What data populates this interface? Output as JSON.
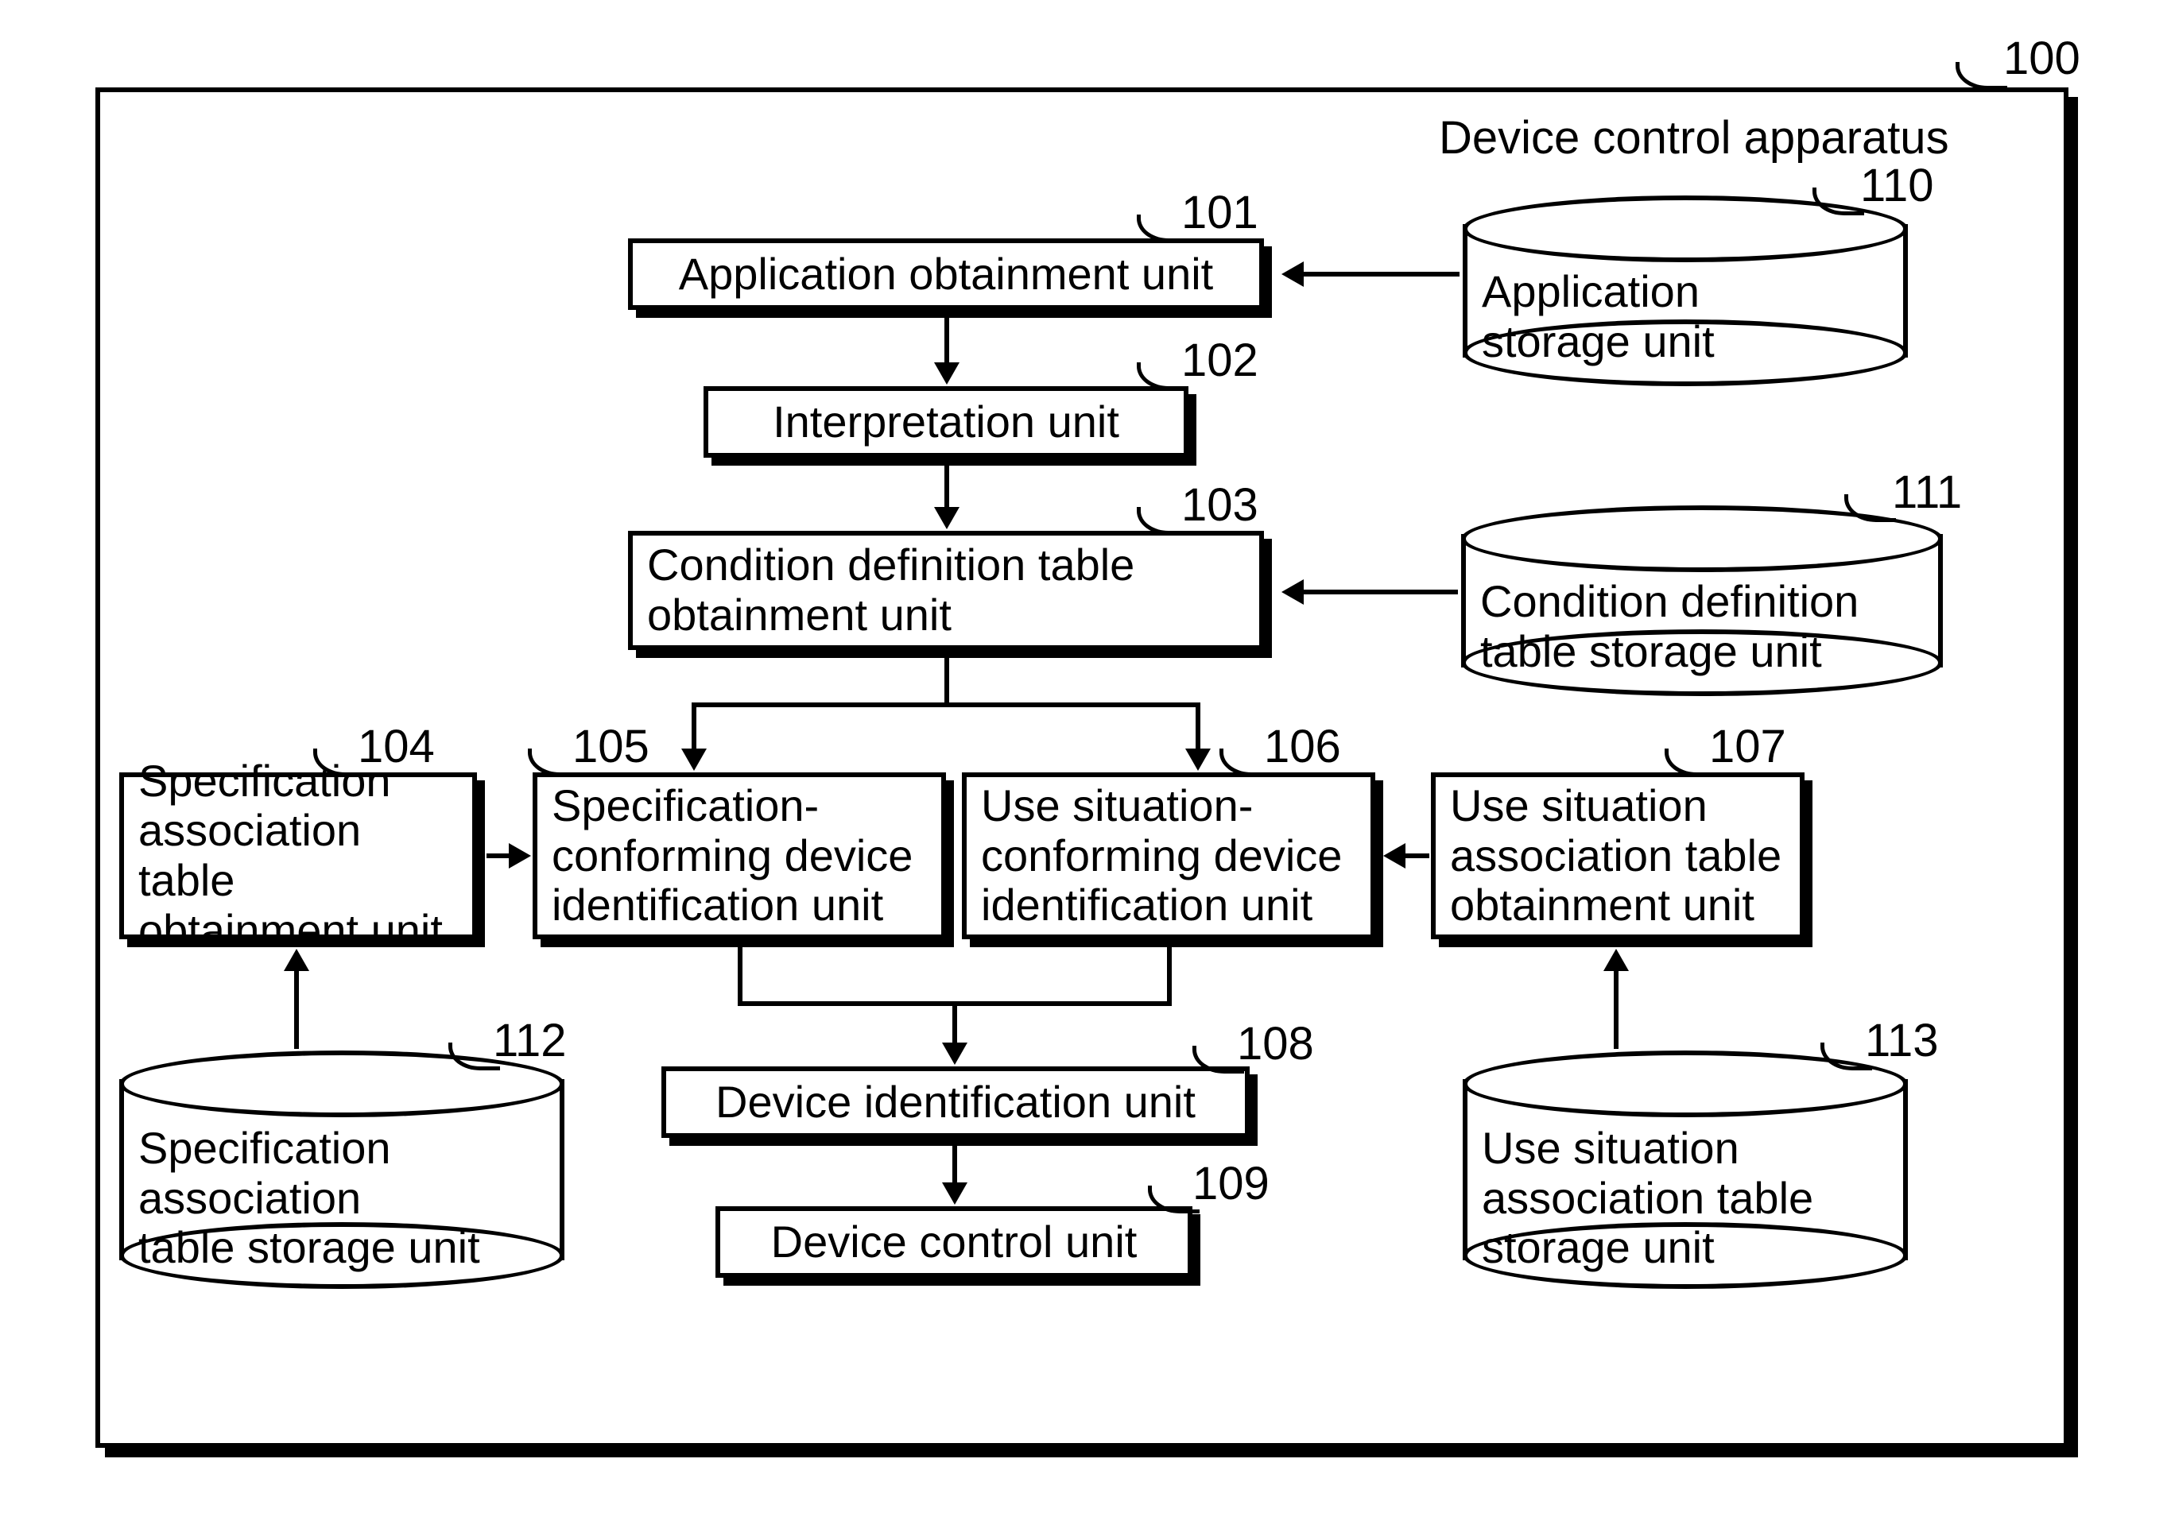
{
  "title": "Device control apparatus",
  "refs": {
    "frame": "100",
    "b101": "101",
    "b102": "102",
    "b103": "103",
    "b104": "104",
    "b105": "105",
    "b106": "106",
    "b107": "107",
    "b108": "108",
    "b109": "109",
    "c110": "110",
    "c111": "111",
    "c112": "112",
    "c113": "113"
  },
  "boxes": {
    "b101": "Application obtainment unit",
    "b102": "Interpretation unit",
    "b103": "Condition definition table\nobtainment unit",
    "b104": "Specification\nassociation table\nobtainment unit",
    "b105": "Specification-\nconforming device\nidentification unit",
    "b106": "Use situation-\nconforming device\nidentification unit",
    "b107": "Use situation\nassociation table\nobtainment unit",
    "b108": "Device identification unit",
    "b109": "Device control unit"
  },
  "cyls": {
    "c110": "Application\nstorage unit",
    "c111": "Condition definition\ntable storage unit",
    "c112": "Specification\nassociation\ntable storage unit",
    "c113": "Use situation\nassociation table\nstorage unit"
  },
  "chart_data": {
    "type": "diagram",
    "title": "Device control apparatus",
    "nodes": [
      {
        "id": "100",
        "label": "Device control apparatus",
        "kind": "container"
      },
      {
        "id": "101",
        "label": "Application obtainment unit",
        "kind": "process"
      },
      {
        "id": "102",
        "label": "Interpretation unit",
        "kind": "process"
      },
      {
        "id": "103",
        "label": "Condition definition table obtainment unit",
        "kind": "process"
      },
      {
        "id": "104",
        "label": "Specification association table obtainment unit",
        "kind": "process"
      },
      {
        "id": "105",
        "label": "Specification-conforming device identification unit",
        "kind": "process"
      },
      {
        "id": "106",
        "label": "Use situation-conforming device identification unit",
        "kind": "process"
      },
      {
        "id": "107",
        "label": "Use situation association table obtainment unit",
        "kind": "process"
      },
      {
        "id": "108",
        "label": "Device identification unit",
        "kind": "process"
      },
      {
        "id": "109",
        "label": "Device control unit",
        "kind": "process"
      },
      {
        "id": "110",
        "label": "Application storage unit",
        "kind": "storage"
      },
      {
        "id": "111",
        "label": "Condition definition table storage unit",
        "kind": "storage"
      },
      {
        "id": "112",
        "label": "Specification association table storage unit",
        "kind": "storage"
      },
      {
        "id": "113",
        "label": "Use situation association table storage unit",
        "kind": "storage"
      }
    ],
    "edges": [
      {
        "from": "110",
        "to": "101"
      },
      {
        "from": "101",
        "to": "102"
      },
      {
        "from": "102",
        "to": "103"
      },
      {
        "from": "111",
        "to": "103"
      },
      {
        "from": "103",
        "to": "105"
      },
      {
        "from": "103",
        "to": "106"
      },
      {
        "from": "104",
        "to": "105"
      },
      {
        "from": "107",
        "to": "106"
      },
      {
        "from": "112",
        "to": "104"
      },
      {
        "from": "113",
        "to": "107"
      },
      {
        "from": "105",
        "to": "108"
      },
      {
        "from": "106",
        "to": "108"
      },
      {
        "from": "108",
        "to": "109"
      }
    ]
  }
}
